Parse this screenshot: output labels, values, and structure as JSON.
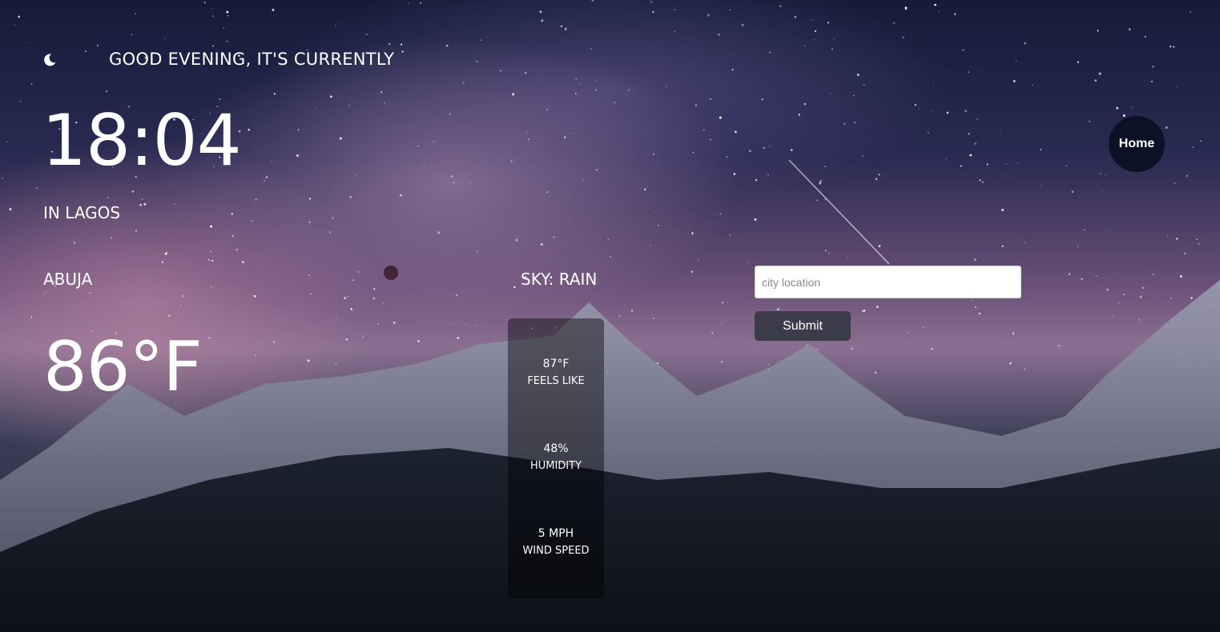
{
  "header": {
    "greeting": "GOOD EVENING, IT'S CURRENTLY",
    "icon": "moon-icon"
  },
  "clock": {
    "time": "18:04",
    "location": "IN LAGOS"
  },
  "weather": {
    "city": "ABUJA",
    "temperature": "86°F",
    "sky": "SKY: RAIN",
    "feels_like_value": "87°F",
    "feels_like_label": "FEELS LIKE",
    "humidity_value": "48%",
    "humidity_label": "HUMIDITY",
    "wind_value": "5 MPH",
    "wind_label": "WIND SPEED"
  },
  "nav": {
    "home_label": "Home"
  },
  "search": {
    "placeholder": "city location",
    "value": "",
    "submit_label": "Submit"
  }
}
